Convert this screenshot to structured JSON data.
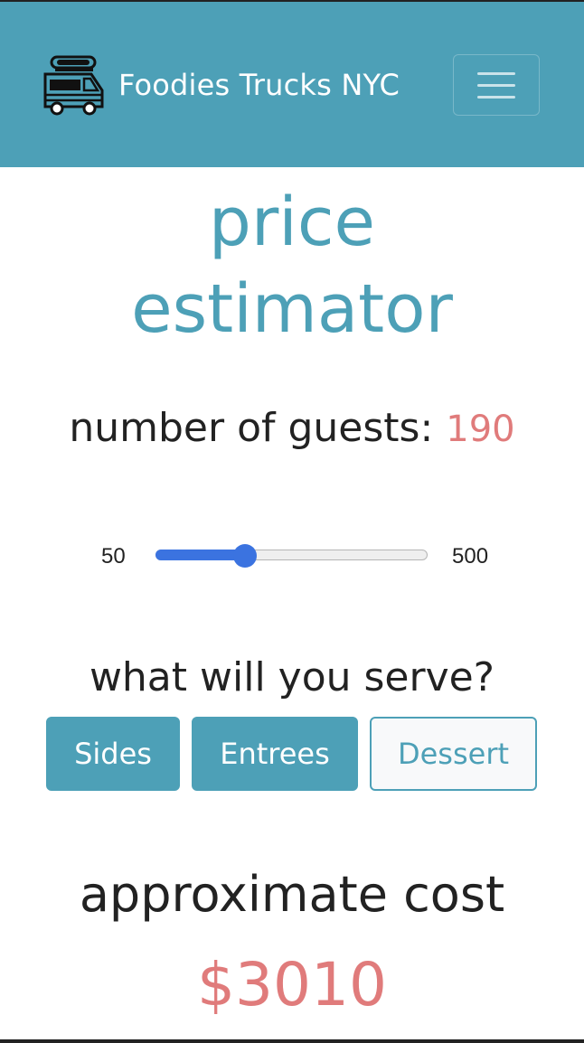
{
  "navbar": {
    "brand_icon": "food-truck-icon",
    "brand_text": "Foodies Trucks NYC",
    "menu_icon": "hamburger-menu-icon",
    "background_color": "#4da0b7"
  },
  "title": {
    "line1": "price",
    "line2": "estimator"
  },
  "guests": {
    "label": "number of guests: ",
    "value": "190",
    "slider_min": "50",
    "slider_max": "500",
    "slider_value": 190
  },
  "serve": {
    "question": "what will you serve?",
    "options": [
      {
        "label": "Sides",
        "selected": true
      },
      {
        "label": "Entrees",
        "selected": true
      },
      {
        "label": "Dessert",
        "selected": false
      }
    ]
  },
  "cost": {
    "label": "approximate cost",
    "value": "$3010"
  },
  "colors": {
    "accent": "#4da0b7",
    "highlight": "#e07b7b",
    "slider": "#3b73e0"
  }
}
